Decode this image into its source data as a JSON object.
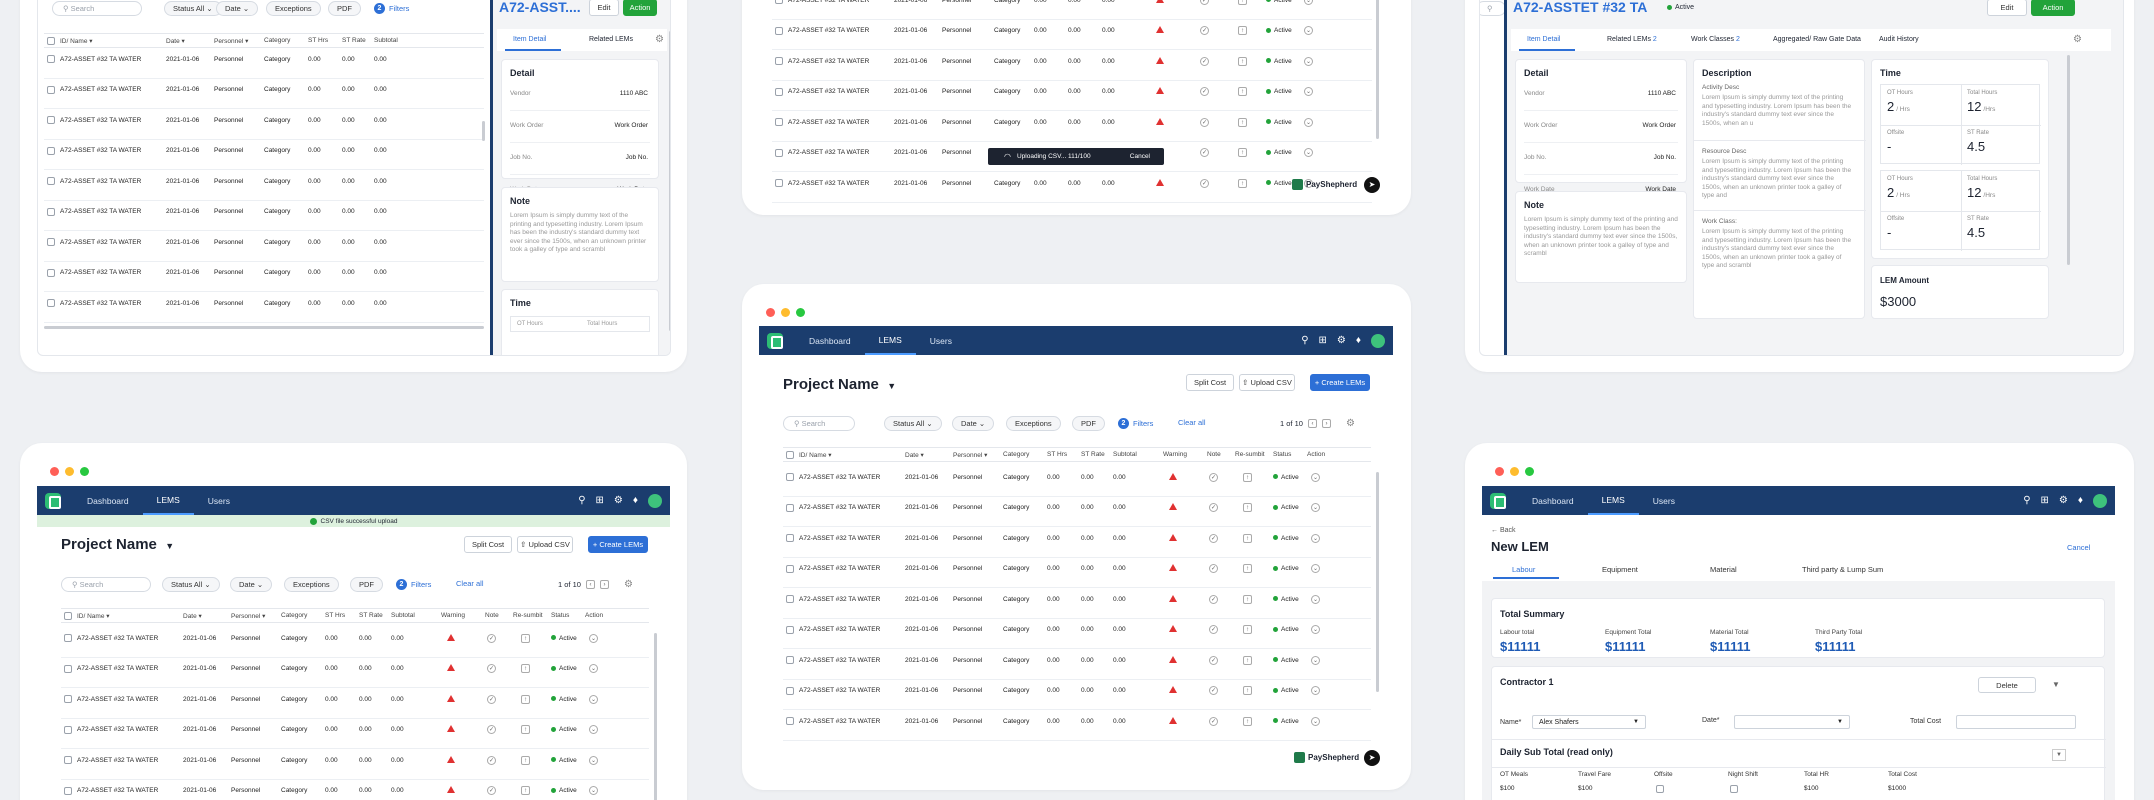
{
  "common": {
    "nav": [
      "Dashboard",
      "LEMS",
      "Users"
    ],
    "project_title": "Project Name",
    "split_cost": "Split Cost",
    "upload_csv": "Upload CSV",
    "create_lems": "+ Create LEMs",
    "search_placeholder": "Search",
    "status_all": "Status All",
    "date": "Date",
    "exceptions": "Exceptions",
    "pdf": "PDF",
    "filters": "Filters",
    "filter_count": "2",
    "clear_all": "Clear all",
    "pager": "1 of 10",
    "columns": [
      "ID/ Name",
      "Date",
      "Personnel",
      "Category",
      "ST Hrs",
      "ST Rate",
      "Subtotal",
      "Warning",
      "Note",
      "Re-sumbit",
      "Status",
      "Action"
    ],
    "row": {
      "id": "A72-ASSET #32 TA WATER",
      "date": "2021-01-06",
      "personnel": "Personnel",
      "category": "Category",
      "st_hrs": "0.00",
      "st_rate": "0.00",
      "subtotal": "0.00",
      "status": "Active"
    },
    "brand": "PayShepherd"
  },
  "card_tl": {
    "asset_title": "A72-ASST....",
    "edit": "Edit",
    "action": "Action",
    "tabs": [
      "Item Detail",
      "Related LEMs"
    ],
    "detail_title": "Detail",
    "detail": [
      {
        "k": "Vendor",
        "v": "1110 ABC"
      },
      {
        "k": "Work Order",
        "v": "Work Order"
      },
      {
        "k": "Job No.",
        "v": "Job No."
      },
      {
        "k": "Work Date",
        "v": "Work Date"
      }
    ],
    "note_title": "Note",
    "note_text": "Lorem Ipsum is simply dummy text of the printing and typesetting industry. Lorem Ipsum has been the industry's standard dummy text ever since the 1500s, when an unknown printer took a galley of type and scrambl",
    "time_title": "Time",
    "time_fields": [
      "OT Hours",
      "Total Hours"
    ]
  },
  "card_tm": {
    "uploading": "Uploading CSV... 111/100",
    "cancel": "Cancel"
  },
  "card_tr": {
    "asset_title": "A72-ASSTET #32 TA",
    "status": "Active",
    "edit": "Edit",
    "action": "Action",
    "tabs": [
      "Item Detail",
      "Related LEMs",
      "Work Classes",
      "Aggregated/ Raw Gate Data",
      "Audit History"
    ],
    "tab_badges": [
      "2",
      "2"
    ],
    "detail_title": "Detail",
    "detail": [
      {
        "k": "Vendor",
        "v": "1110 ABC"
      },
      {
        "k": "Work Order",
        "v": "Work Order"
      },
      {
        "k": "Job No.",
        "v": "Job No."
      },
      {
        "k": "Work Date",
        "v": "Work Date"
      }
    ],
    "note_title": "Note",
    "note_text": "Lorem Ipsum is simply dummy text of the printing and typesetting industry. Lorem Ipsum has been the industry's standard dummy text ever since the 1500s, when an unknown printer took a galley of type and scrambl",
    "desc_title": "Description",
    "activity_label": "Activity Desc",
    "activity_text": "Lorem Ipsum is simply dummy text of the printing and typesetting industry. Lorem Ipsum has been the industry's standard dummy text ever since the 1500s, when an u",
    "resource_label": "Resource Desc",
    "resource_text": "Lorem Ipsum is simply dummy text of the printing and typesetting industry. Lorem Ipsum has been the industry's standard dummy text ever since the 1500s, when an unknown printer took a galley of type and",
    "workclass_label": "Work Class:",
    "workclass_text": "Lorem Ipsum is simply dummy text of the printing and typesetting industry. Lorem Ipsum has been the industry's standard dummy text ever since the 1500s, when an unknown printer took a galley of type and scrambl",
    "time_title": "Time",
    "time_blocks": [
      {
        "ot_label": "OT Hours",
        "ot": "2",
        "ot_unit": "/ Hrs",
        "total_label": "Total Hours",
        "total": "12",
        "total_unit": "/Hrs",
        "off_label": "Offsite",
        "off": "-",
        "rate_label": "ST Rate",
        "rate": "4.5"
      },
      {
        "ot_label": "OT Hours",
        "ot": "2",
        "ot_unit": "/ Hrs",
        "total_label": "Total Hours",
        "total": "12",
        "total_unit": "/Hrs",
        "off_label": "Offsite",
        "off": "-",
        "rate_label": "ST Rate",
        "rate": "4.5"
      }
    ],
    "lem_amount_label": "LEM Amount",
    "lem_amount": "$3000"
  },
  "card_bl": {
    "banner": "CSV file successful upload"
  },
  "card_br": {
    "back": "← Back",
    "title": "New LEM",
    "cancel": "Cancel",
    "tabs": [
      "Labour",
      "Equipment",
      "Material",
      "Third party & Lump Sum"
    ],
    "summary_title": "Total Summary",
    "totals": [
      {
        "label": "Labour total",
        "value": "$11111"
      },
      {
        "label": "Equipment Total",
        "value": "$11111"
      },
      {
        "label": "Material Total",
        "value": "$11111"
      },
      {
        "label": "Third Party Total",
        "value": "$11111"
      }
    ],
    "contractor_title": "Contractor 1",
    "delete": "Delete",
    "name_label": "Name*",
    "name_value": "Alex Shafers",
    "date_label": "Date*",
    "total_cost_label": "Total Cost",
    "daily_title": "Daily Sub Total (read only)",
    "daily_cols": [
      "OT Meals",
      "Travel Fare",
      "Offsite",
      "Night Shift",
      "Total HR",
      "Total Cost"
    ],
    "daily_values": [
      "$100",
      "$100",
      "",
      "",
      "$100",
      "$1000"
    ]
  }
}
